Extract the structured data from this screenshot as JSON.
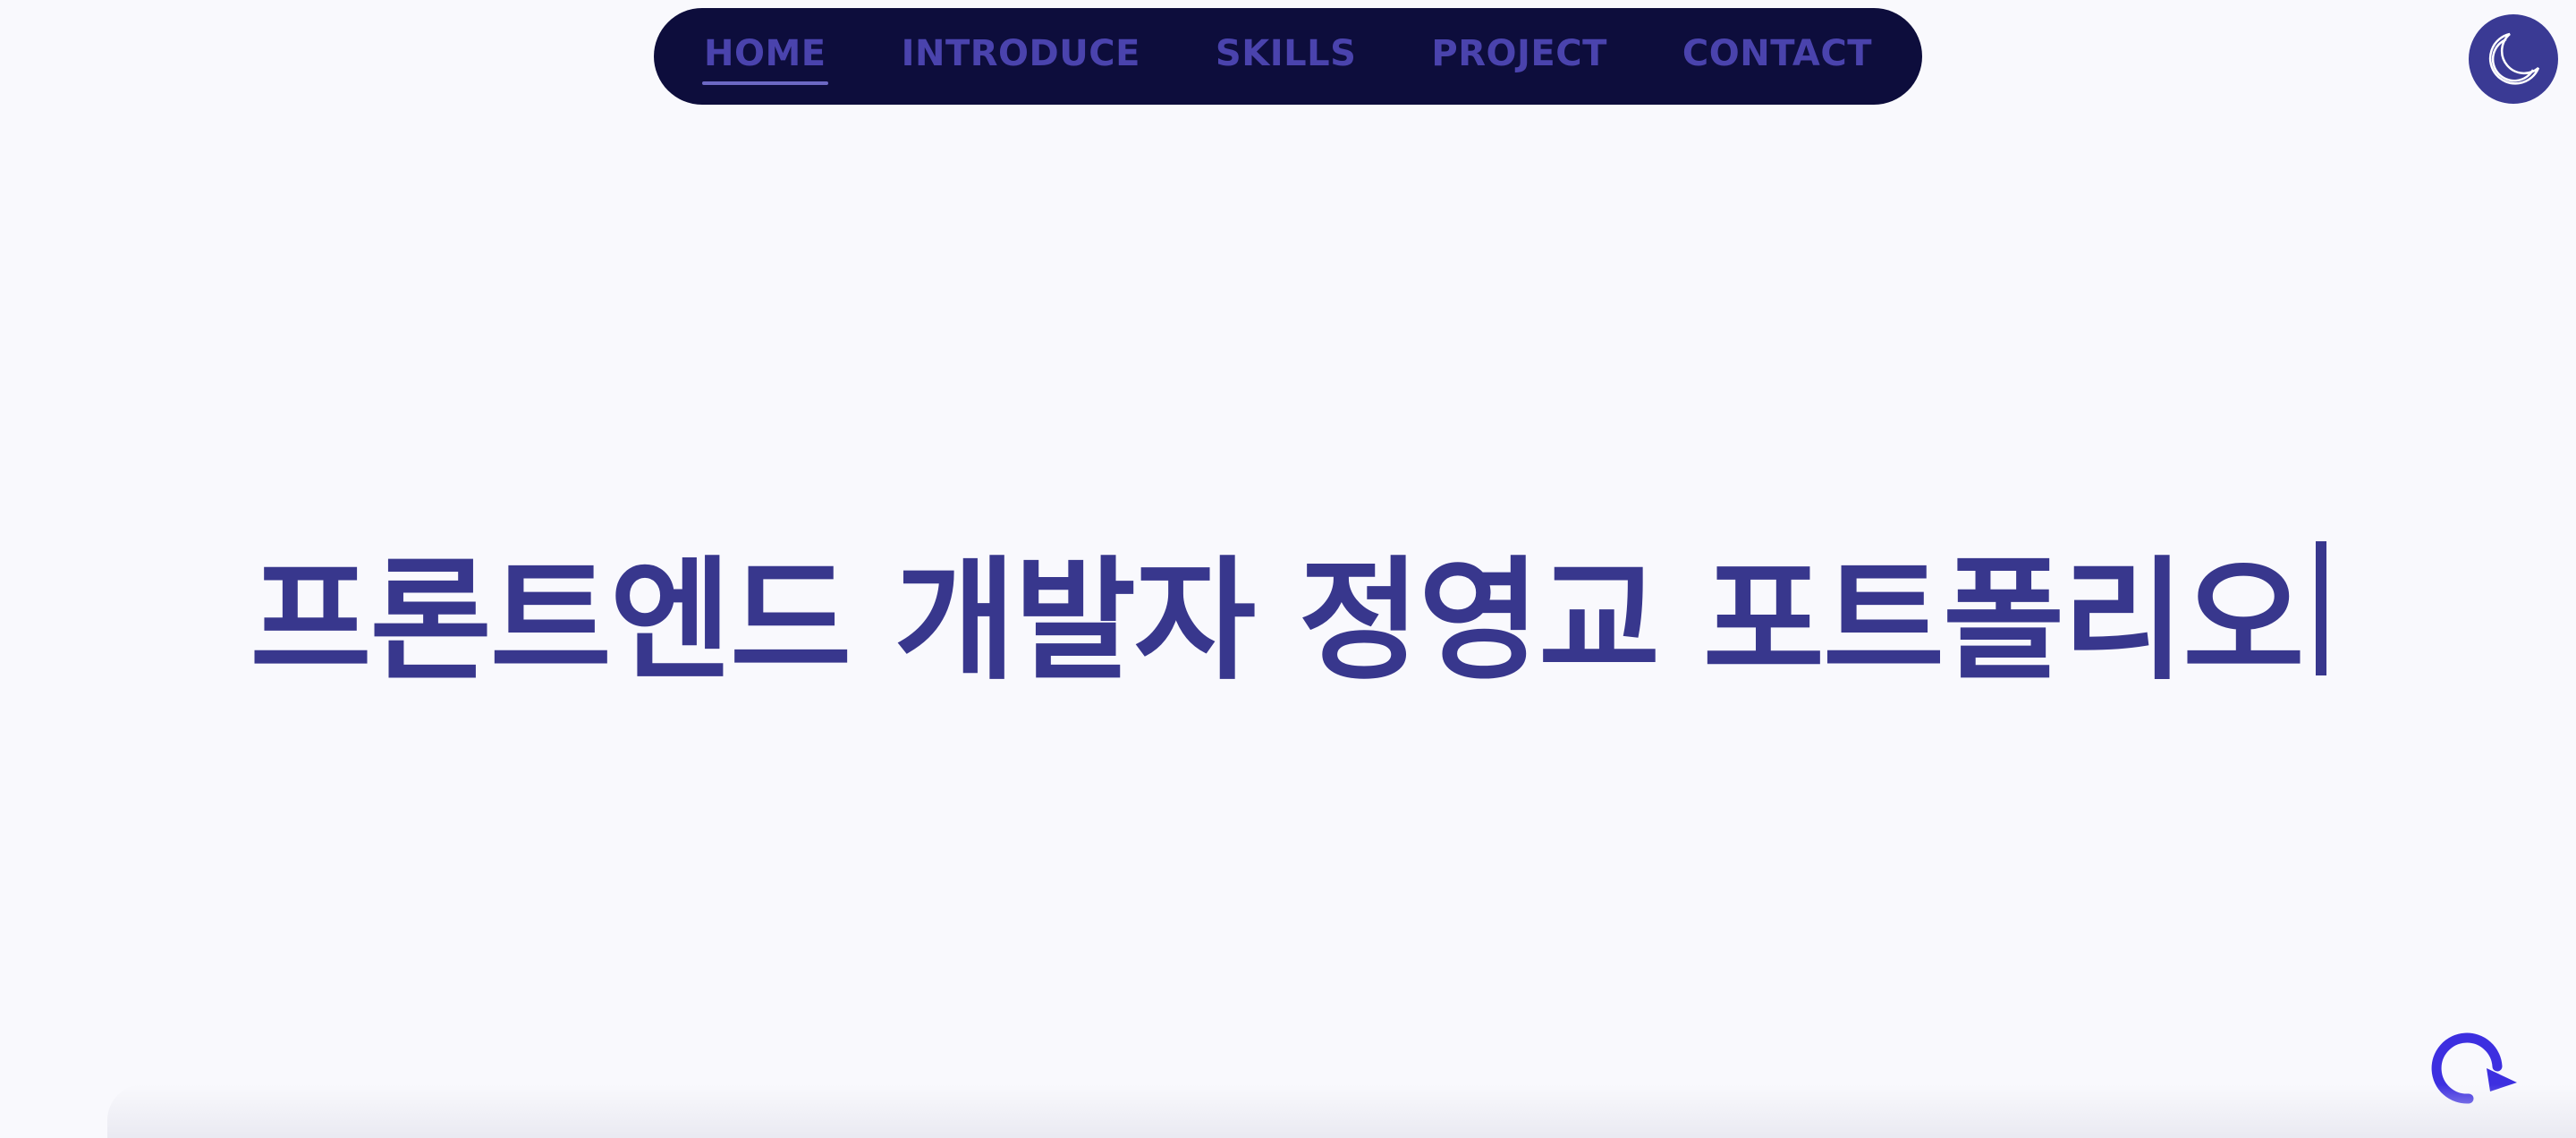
{
  "nav": {
    "items": [
      {
        "label": "HOME",
        "active": true
      },
      {
        "label": "INTRODUCE",
        "active": false
      },
      {
        "label": "SKILLS",
        "active": false
      },
      {
        "label": "PROJECT",
        "active": false
      },
      {
        "label": "CONTACT",
        "active": false
      }
    ]
  },
  "theme_toggle": {
    "icon": "moon-icon"
  },
  "hero": {
    "title": "프론트엔드 개발자 정영교 포트폴리오"
  },
  "refresh": {
    "icon": "refresh-icon"
  },
  "colors": {
    "background": "#f9f9fd",
    "navbar": "#0d0d3c",
    "nav_text": "#4a43ad",
    "title": "#38378d",
    "toggle": "#3a3a94",
    "refresh": "#3d2fe0"
  }
}
